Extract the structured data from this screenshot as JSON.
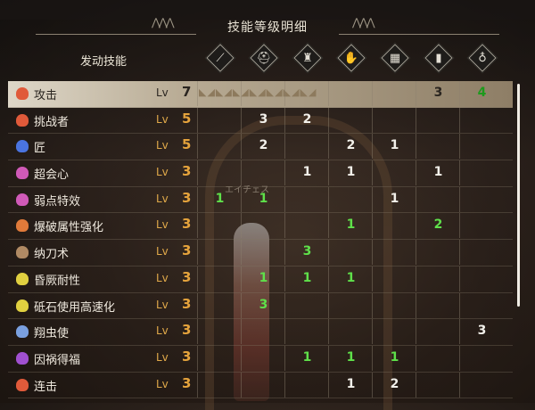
{
  "title": "技能等级明细",
  "section_label": "发动技能",
  "level_prefix": "Lv",
  "watermark": "エイチェス",
  "header_icons": [
    {
      "name": "weapon-icon",
      "glyph": "⟋"
    },
    {
      "name": "helmet-icon",
      "glyph": "⛑"
    },
    {
      "name": "chest-armor-icon",
      "glyph": "♜"
    },
    {
      "name": "arm-armor-icon",
      "glyph": "✋"
    },
    {
      "name": "waist-armor-icon",
      "glyph": "▦"
    },
    {
      "name": "leg-armor-icon",
      "glyph": "▮"
    },
    {
      "name": "talisman-icon",
      "glyph": "♁"
    }
  ],
  "skills": [
    {
      "name": "攻击",
      "level": "7",
      "icon_color": "#e05a3a",
      "cells": [
        "",
        "",
        "",
        "",
        "",
        "3",
        "4"
      ],
      "green": [
        false,
        false,
        false,
        false,
        false,
        false,
        true
      ],
      "selected": true
    },
    {
      "name": "挑战者",
      "level": "5",
      "icon_color": "#e05a3a",
      "cells": [
        "",
        "3",
        "2",
        "",
        "",
        "",
        ""
      ],
      "green": [
        false,
        false,
        false,
        false,
        false,
        false,
        false
      ]
    },
    {
      "name": "匠",
      "level": "5",
      "icon_color": "#4a74e0",
      "cells": [
        "",
        "2",
        "",
        "2",
        "1",
        "",
        ""
      ],
      "green": [
        false,
        false,
        false,
        false,
        false,
        false,
        false
      ]
    },
    {
      "name": "超会心",
      "level": "3",
      "icon_color": "#d05ab8",
      "cells": [
        "",
        "",
        "1",
        "1",
        "",
        "1",
        ""
      ],
      "green": [
        false,
        false,
        false,
        false,
        false,
        false,
        false
      ]
    },
    {
      "name": "弱点特效",
      "level": "3",
      "icon_color": "#d05ab8",
      "cells": [
        "1",
        "1",
        "",
        "",
        "1",
        "",
        ""
      ],
      "green": [
        true,
        true,
        false,
        false,
        false,
        false,
        false
      ]
    },
    {
      "name": "爆破属性强化",
      "level": "3",
      "icon_color": "#e07a3a",
      "cells": [
        "",
        "",
        "",
        "1",
        "",
        "2",
        ""
      ],
      "green": [
        false,
        false,
        false,
        true,
        false,
        true,
        false
      ]
    },
    {
      "name": "纳刀术",
      "level": "3",
      "icon_color": "#b08a64",
      "cells": [
        "",
        "",
        "3",
        "",
        "",
        "",
        ""
      ],
      "green": [
        false,
        false,
        true,
        false,
        false,
        false,
        false
      ]
    },
    {
      "name": "昏厥耐性",
      "level": "3",
      "icon_color": "#e0d040",
      "cells": [
        "",
        "1",
        "1",
        "1",
        "",
        "",
        ""
      ],
      "green": [
        false,
        true,
        true,
        true,
        false,
        false,
        false
      ]
    },
    {
      "name": "砥石使用高速化",
      "level": "3",
      "icon_color": "#e0d040",
      "cells": [
        "",
        "3",
        "",
        "",
        "",
        "",
        ""
      ],
      "green": [
        false,
        true,
        false,
        false,
        false,
        false,
        false
      ]
    },
    {
      "name": "翔虫使",
      "level": "3",
      "icon_color": "#7aa0e0",
      "cells": [
        "",
        "",
        "",
        "",
        "",
        "",
        "3"
      ],
      "green": [
        false,
        false,
        false,
        false,
        false,
        false,
        false
      ]
    },
    {
      "name": "因祸得福",
      "level": "3",
      "icon_color": "#a050d0",
      "cells": [
        "",
        "",
        "1",
        "1",
        "1",
        "",
        ""
      ],
      "green": [
        false,
        false,
        true,
        true,
        true,
        false,
        false
      ]
    },
    {
      "name": "连击",
      "level": "3",
      "icon_color": "#e05a3a",
      "cells": [
        "",
        "",
        "",
        "1",
        "2",
        "",
        ""
      ],
      "green": [
        false,
        false,
        false,
        false,
        false,
        false,
        false
      ]
    }
  ]
}
